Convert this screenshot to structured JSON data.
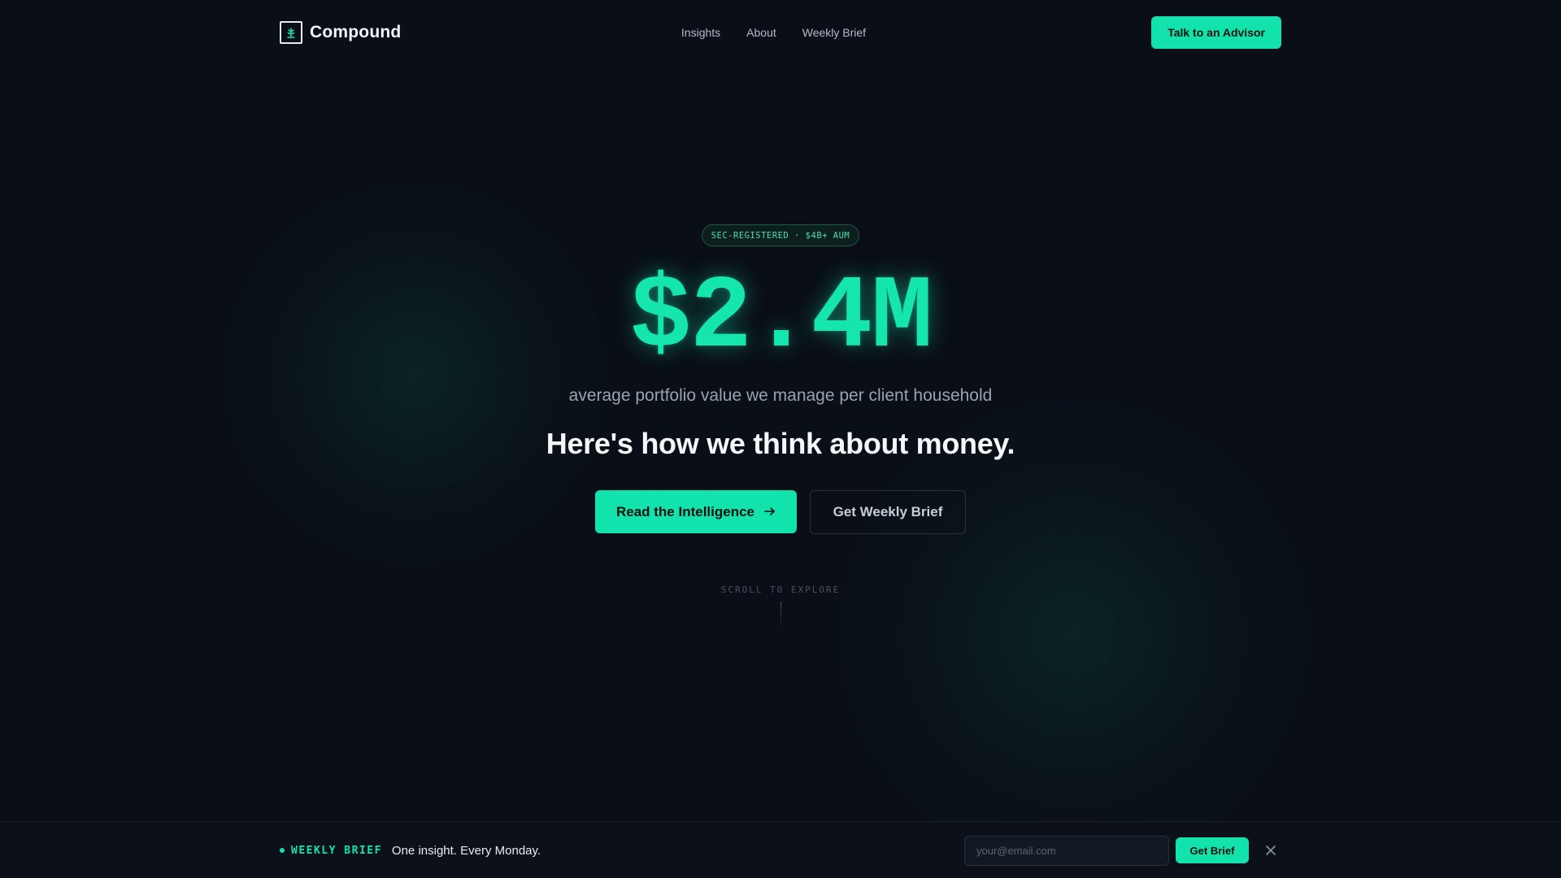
{
  "header": {
    "brand": "Compound",
    "logo_icon": "tree-chart-icon",
    "nav": [
      "Insights",
      "About",
      "Weekly Brief"
    ],
    "cta": "Talk to an Advisor"
  },
  "hero": {
    "badge": "SEC-REGISTERED · $4B+ AUM",
    "big_number": "$2.4M",
    "subline": "average portfolio value we manage per client household",
    "headline": "Here's how we think about money.",
    "primary_cta": "Read the Intelligence",
    "primary_cta_icon": "arrow-right-icon",
    "secondary_cta": "Get Weekly Brief",
    "scroll_hint": "SCROLL TO EXPLORE"
  },
  "brief_bar": {
    "tag": "WEEKLY BRIEF",
    "text": "One insight. Every Monday.",
    "email_placeholder": "your@email.com",
    "button": "Get Brief",
    "close_icon": "close-icon"
  },
  "colors": {
    "background": "#0a0e16",
    "accent": "#12e3ad",
    "text_primary": "#f4f6fa",
    "text_muted": "#9aa3b0"
  }
}
